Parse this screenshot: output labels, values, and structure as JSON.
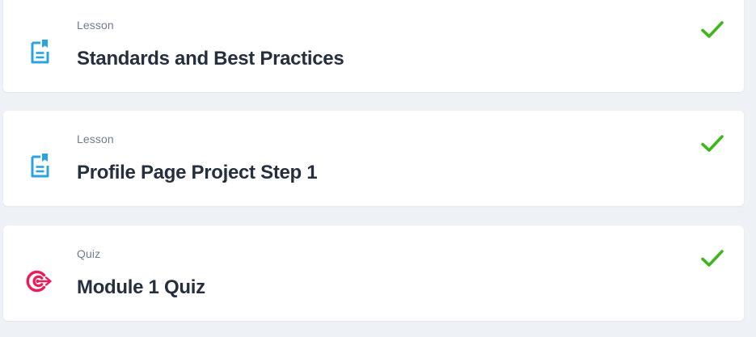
{
  "colors": {
    "background": "#eef2f6",
    "card": "#ffffff",
    "lesson_icon": "#2aa4e0",
    "quiz_icon": "#ec1b5a",
    "check": "#3fb61c",
    "title_text": "#262f3e",
    "label_text": "#707c8c"
  },
  "items": [
    {
      "type": "Lesson",
      "title": "Standards and Best Practices",
      "icon": "lesson-document-icon",
      "status": "completed",
      "status_icon": "checkmark-icon"
    },
    {
      "type": "Lesson",
      "title": "Profile Page Project Step 1",
      "icon": "lesson-document-icon",
      "status": "completed",
      "status_icon": "checkmark-icon"
    },
    {
      "type": "Quiz",
      "title": "Module 1 Quiz",
      "icon": "quiz-target-icon",
      "status": "completed",
      "status_icon": "checkmark-icon"
    }
  ]
}
